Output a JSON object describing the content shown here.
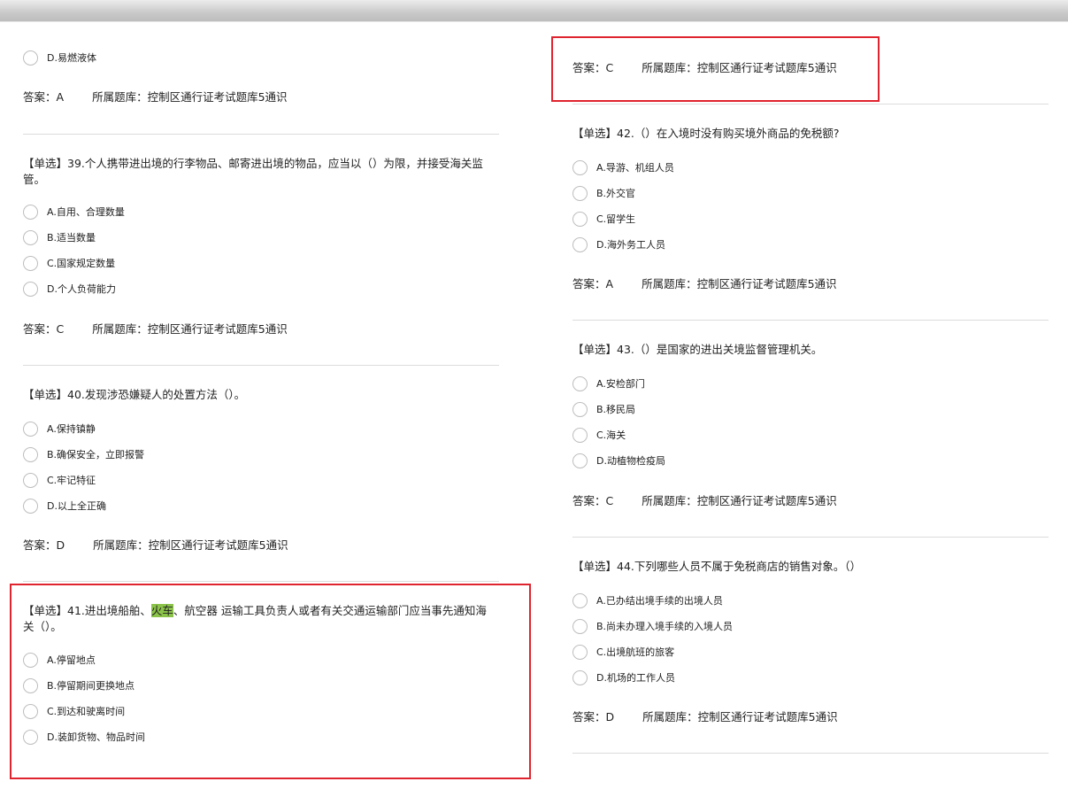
{
  "left_column": {
    "tail_option": "D.易燃液体",
    "answer_prev": {
      "label": "答案：",
      "value": "A",
      "bank_label": "所属题库：",
      "bank": "控制区通行证考试题库5通识"
    },
    "q39": {
      "title": "【单选】39.个人携带进出境的行李物品、邮寄进出境的物品，应当以（）为限，并接受海关监管。",
      "options": [
        "A.自用、合理数量",
        "B.适当数量",
        "C.国家规定数量",
        "D.个人负荷能力"
      ],
      "answer": {
        "label": "答案：",
        "value": "C",
        "bank_label": "所属题库：",
        "bank": "控制区通行证考试题库5通识"
      }
    },
    "q40": {
      "title": "【单选】40.发现涉恐嫌疑人的处置方法（）。",
      "options": [
        "A.保持镇静",
        "B.确保安全，立即报警",
        "C.牢记特征",
        "D.以上全正确"
      ],
      "answer": {
        "label": "答案：",
        "value": "D",
        "bank_label": "所属题库：",
        "bank": "控制区通行证考试题库5通识"
      }
    },
    "q41": {
      "title_before": "【单选】41.进出境船舶、",
      "title_highlight": "火车",
      "title_after": "、航空器 运输工具负责人或者有关交通运输部门应当事先通知海关（）。",
      "options": [
        "A.停留地点",
        "B.停留期间更换地点",
        "C.到达和驶离时间",
        "D.装卸货物、物品时间"
      ]
    }
  },
  "right_column": {
    "answer_41": {
      "label": "答案：",
      "value": "C",
      "bank_label": "所属题库：",
      "bank": "控制区通行证考试题库5通识"
    },
    "q42": {
      "title": "【单选】42.（）在入境时没有购买境外商品的免税额?",
      "options": [
        "A.导游、机组人员",
        "B.外交官",
        "C.留学生",
        "D.海外务工人员"
      ],
      "answer": {
        "label": "答案：",
        "value": "A",
        "bank_label": "所属题库：",
        "bank": "控制区通行证考试题库5通识"
      }
    },
    "q43": {
      "title": "【单选】43.（）是国家的进出关境监督管理机关。",
      "options": [
        "A.安检部门",
        "B.移民局",
        "C.海关",
        "D.动植物检疫局"
      ],
      "answer": {
        "label": "答案：",
        "value": "C",
        "bank_label": "所属题库：",
        "bank": "控制区通行证考试题库5通识"
      }
    },
    "q44": {
      "title": "【单选】44.下列哪些人员不属于免税商店的销售对象。（）",
      "options": [
        "A.已办结出境手续的出境人员",
        "B.尚未办理入境手续的入境人员",
        "C.出境航班的旅客",
        "D.机场的工作人员"
      ],
      "answer": {
        "label": "答案：",
        "value": "D",
        "bank_label": "所属题库：",
        "bank": "控制区通行证考试题库5通识"
      }
    }
  },
  "colors": {
    "highlight": "#8bc34a",
    "annotation_box": "#e0242f",
    "divider": "#dcdcdc"
  }
}
